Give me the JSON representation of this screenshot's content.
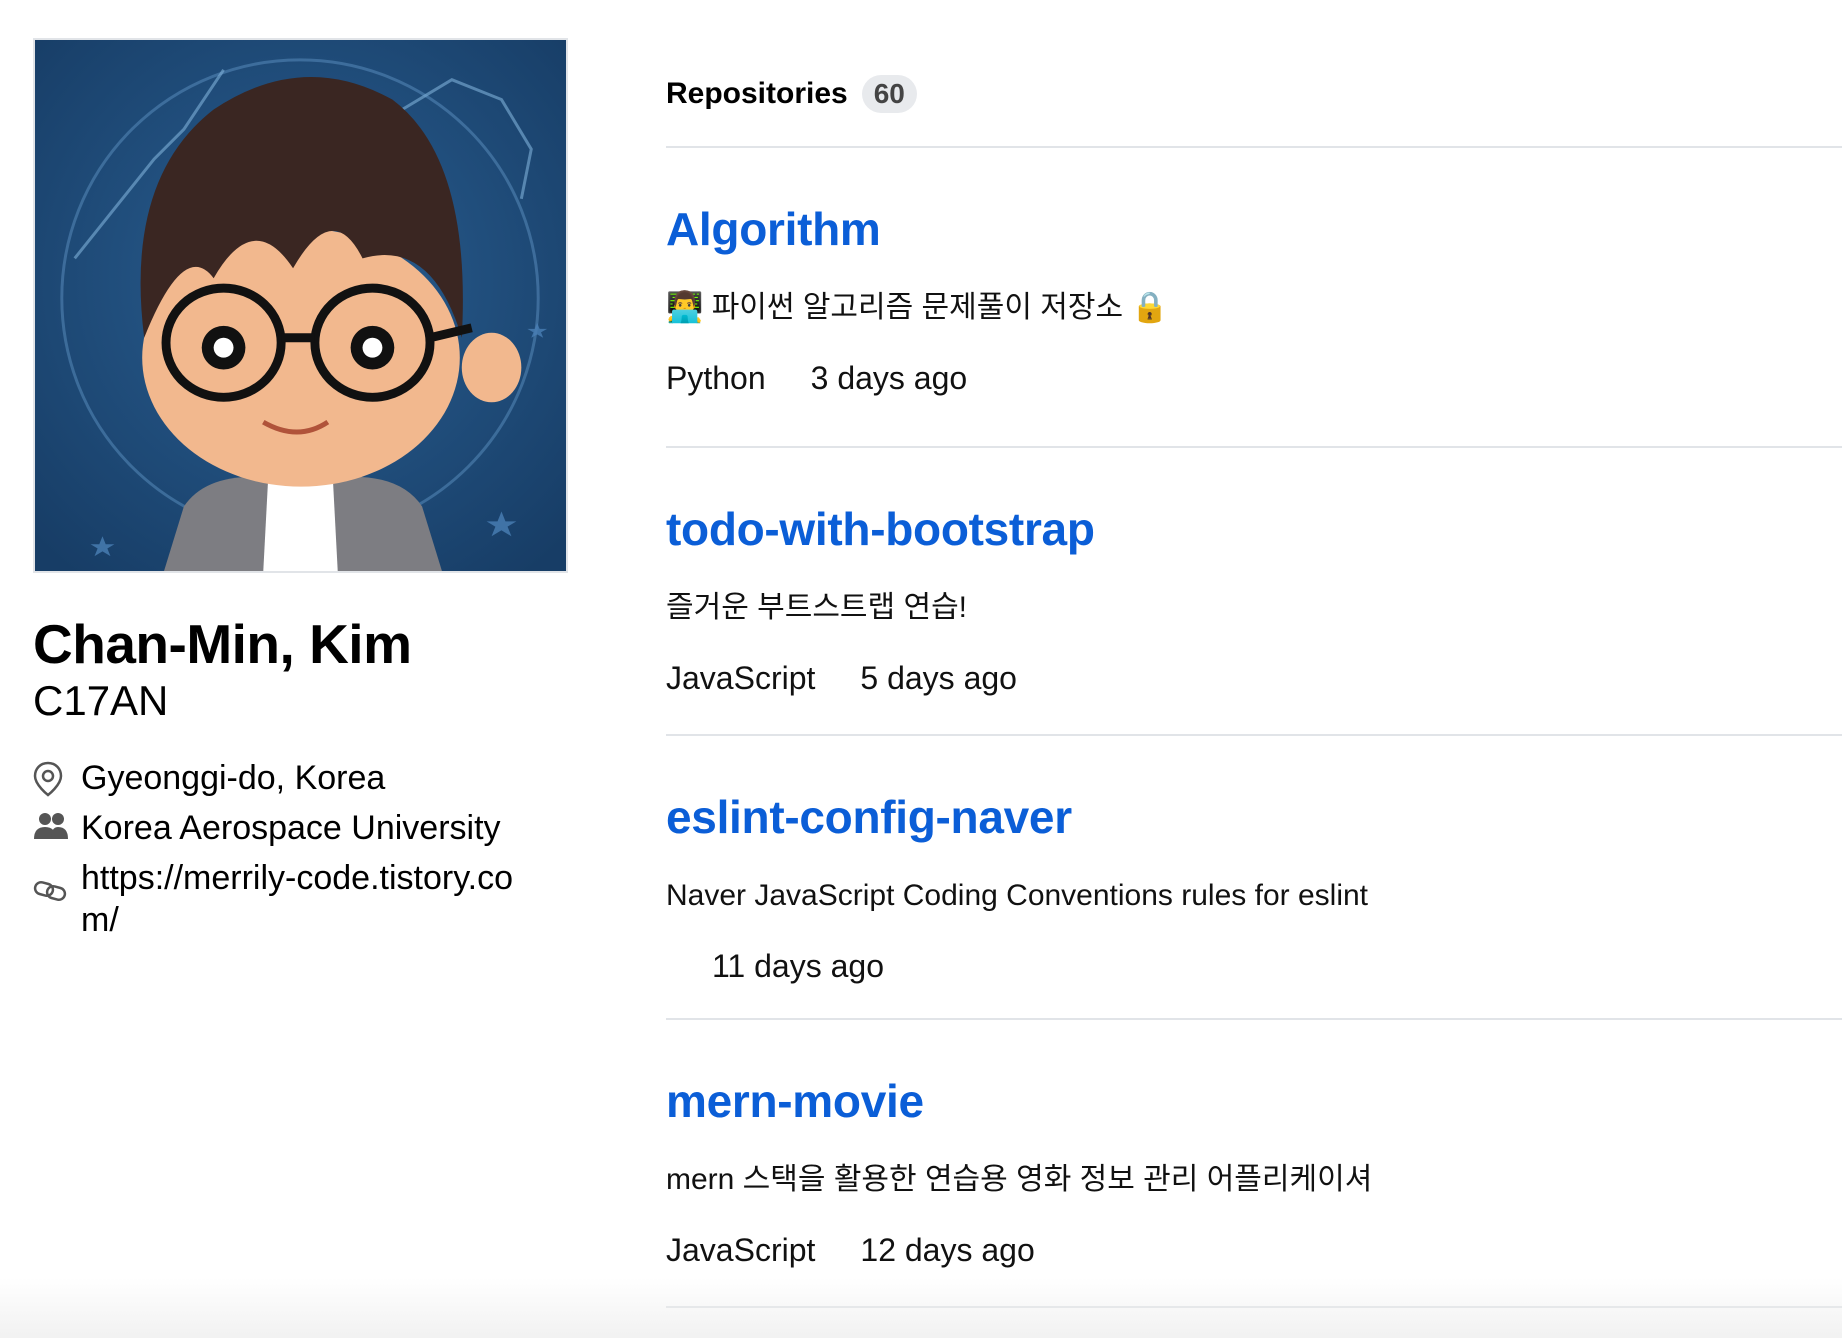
{
  "profile": {
    "full_name": "Chan-Min, Kim",
    "username": "C17AN",
    "location": "Gyeonggi-do, Korea",
    "organization": "Korea Aerospace University",
    "website": "https://merrily-code.tistory.com/"
  },
  "repositories": {
    "title": "Repositories",
    "count": "60",
    "items": [
      {
        "name": "Algorithm",
        "description": "👨‍💻 파이썬 알고리즘 문제풀이 저장소 🔒",
        "language": "Python",
        "updated": "3 days ago"
      },
      {
        "name": "todo-with-bootstrap",
        "description": "즐거운 부트스트랩 연습!",
        "language": "JavaScript",
        "updated": "5 days ago"
      },
      {
        "name": "eslint-config-naver",
        "description": "Naver JavaScript Coding Conventions rules for eslint",
        "language": "",
        "updated": "11 days ago"
      },
      {
        "name": "mern-movie",
        "description": "mern 스택을 활용한 연습용 영화 정보 관리 어플리케이셔",
        "language": "JavaScript",
        "updated": "12 days ago"
      }
    ]
  },
  "colors": {
    "link": "#0b5ed7",
    "divider": "#e1e4e8",
    "avatar_bg": "#1c4a78"
  }
}
